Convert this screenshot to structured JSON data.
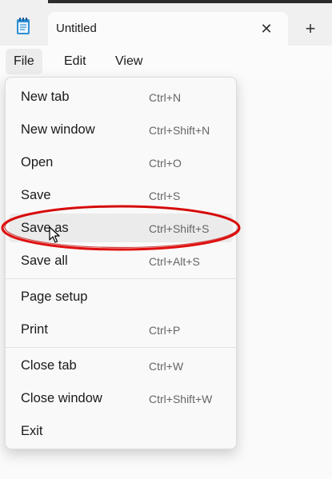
{
  "tab": {
    "title": "Untitled",
    "close_icon": "close-icon",
    "new_tab_icon": "plus-icon"
  },
  "menubar": {
    "items": [
      "File",
      "Edit",
      "View"
    ],
    "active": "File"
  },
  "file_menu": {
    "items": [
      {
        "label": "New tab",
        "shortcut": "Ctrl+N"
      },
      {
        "label": "New window",
        "shortcut": "Ctrl+Shift+N"
      },
      {
        "label": "Open",
        "shortcut": "Ctrl+O"
      },
      {
        "label": "Save",
        "shortcut": "Ctrl+S"
      },
      {
        "label": "Save as",
        "shortcut": "Ctrl+Shift+S"
      },
      {
        "label": "Save all",
        "shortcut": "Ctrl+Alt+S"
      },
      {
        "label": "Page setup",
        "shortcut": ""
      },
      {
        "label": "Print",
        "shortcut": "Ctrl+P"
      },
      {
        "label": "Close tab",
        "shortcut": "Ctrl+W"
      },
      {
        "label": "Close window",
        "shortcut": "Ctrl+Shift+W"
      },
      {
        "label": "Exit",
        "shortcut": ""
      }
    ],
    "hovered": "Save as"
  },
  "annotation": {
    "color": "#e01010",
    "shape": "ellipse",
    "target": "Save as"
  }
}
